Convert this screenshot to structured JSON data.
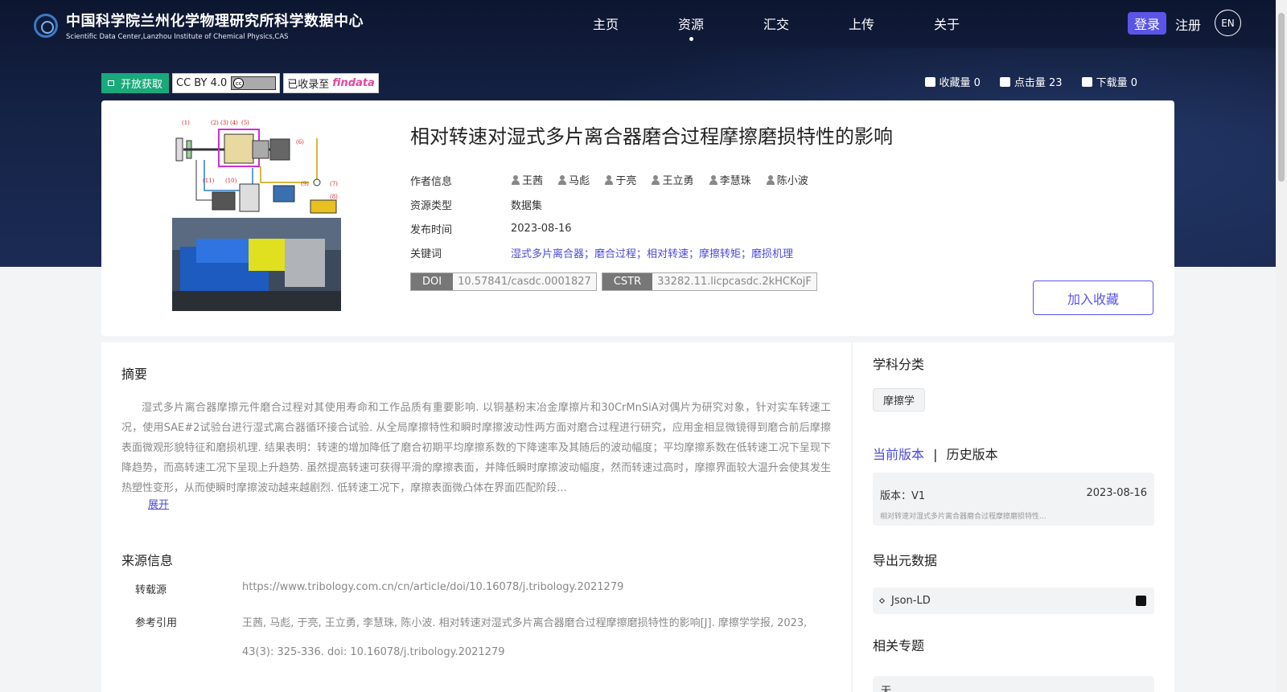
{
  "header": {
    "logo_cn": "中国科学院兰州化学物理研究所科学数据中心",
    "logo_en": "Scientific Data Center,Lanzhou Institute of Chemical Physics,CAS",
    "nav": [
      "主页",
      "资源",
      "汇交",
      "上传",
      "关于"
    ],
    "active_nav": "资源",
    "login": "登录",
    "register": "注册",
    "lang": "EN"
  },
  "badges": {
    "open_access": "开放获取",
    "license": "CC BY 4.0",
    "cc_icon": "cc",
    "indexed": "已收录至",
    "indexed_logo": "findata"
  },
  "stats": {
    "favorites": "收藏量 0",
    "views": "点击量 23",
    "downloads": "下载量 0"
  },
  "dataset": {
    "title": "相对转速对湿式多片离合器磨合过程摩擦磨损特性的影响",
    "labels": {
      "authors": "作者信息",
      "type": "资源类型",
      "date": "发布时间",
      "keywords": "关键词"
    },
    "authors": [
      "王茜",
      "马彪",
      "于亮",
      "王立勇",
      "李慧珠",
      "陈小波"
    ],
    "type": "数据集",
    "date": "2023-08-16",
    "keywords": "湿式多片离合器；磨合过程；相对转速；摩擦转矩；磨损机理",
    "doi_label": "DOI",
    "doi": "10.57841/casdc.0001827",
    "cstr_label": "CSTR",
    "cstr": "33282.11.licpcasdc.2kHCKojF",
    "fav_button": "加入收藏",
    "cover_labels": [
      "(1)",
      "(2)",
      "(3)",
      "(4)",
      "(5)",
      "(6)",
      "(7)",
      "(8)",
      "(9)",
      "(10)",
      "(11)"
    ]
  },
  "abstract": {
    "title": "摘要",
    "text": "湿式多片离合器摩擦元件磨合过程对其使用寿命和工作品质有重要影响. 以铜基粉末冶金摩擦片和30CrMnSiA对偶片为研究对象，针对实车转速工况，使用SAE#2试验台进行湿式离合器循环接合试验. 从全局摩擦特性和瞬时摩擦波动性两方面对磨合过程进行研究，应用金相显微镜得到磨合前后摩擦表面微观形貌特征和磨损机理. 结果表明：转速的增加降低了磨合初期平均摩擦系数的下降速率及其随后的波动幅度；平均摩擦系数在低转速工况下呈现下降趋势，而高转速工况下呈现上升趋势. 虽然提高转速可获得平滑的摩擦表面，并降低瞬时摩擦波动幅度，然而转速过高时，摩擦界面较大温升会使其发生热塑性变形，从而使瞬时摩擦波动越来越剧烈. 低转速工况下，摩擦表面微凸体在界面匹配阶段...",
    "expand": "展开"
  },
  "source": {
    "title": "来源信息",
    "repost_label": "转载源",
    "repost_url": "https://www.tribology.com.cn/cn/article/doi/10.16078/j.tribology.2021279",
    "cite_label": "参考引用",
    "cite_line1": "王茜, 马彪, 于亮, 王立勇, 李慧珠, 陈小波. 相对转速对湿式多片离合器磨合过程摩擦磨损特性的影响[J]. 摩擦学学报, 2023,",
    "cite_line2": "43(3): 325-336. doi: 10.16078/j.tribology.2021279"
  },
  "sidebar": {
    "subject_title": "学科分类",
    "subject_tag": "摩擦学",
    "current_version": "当前版本",
    "sep": "|",
    "history_version": "历史版本",
    "version_label": "版本：V1",
    "version_date": "2023-08-16",
    "version_title": "相对转速对湿式多片离合器磨合过程摩擦磨损特性...",
    "export_title": "导出元数据",
    "export_format": "Json-LD",
    "topic_title": "相关专题",
    "topic_value": "无"
  },
  "colors": {
    "accent": "#5a55e6",
    "link": "#4a4ad8",
    "open_access": "#19a97b",
    "header_bg": "#152346"
  }
}
